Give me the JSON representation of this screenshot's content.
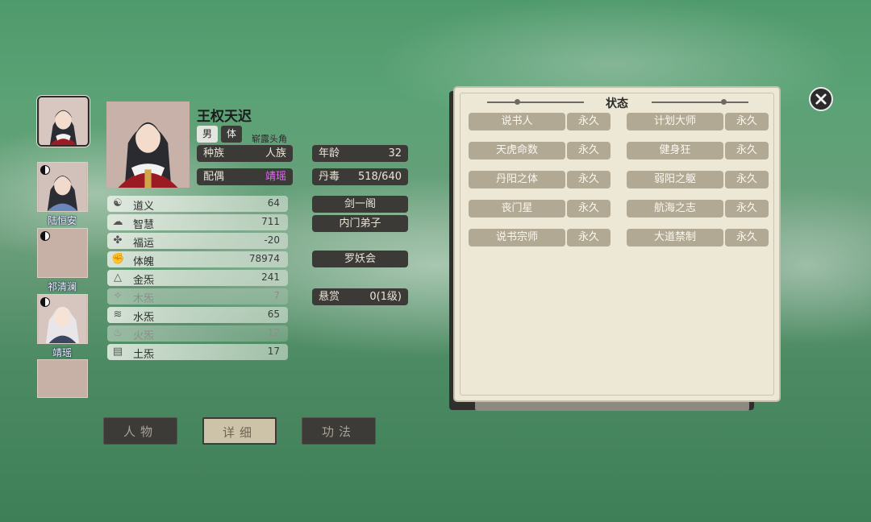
{
  "character": {
    "name": "王权天迟",
    "gender": "男",
    "type_tag": "体",
    "title": "崭露头角",
    "race_label": "种族",
    "race_value": "人族",
    "spouse_label": "配偶",
    "spouse_value": "靖瑶",
    "age_label": "年龄",
    "age_value": "32",
    "poison_label": "丹毒",
    "poison_value": "518/640",
    "sect": "剑一阁",
    "rank": "内门弟子",
    "organization": "罗妖会",
    "bounty_label": "悬赏",
    "bounty_value": "0(1级)"
  },
  "attributes": [
    {
      "label": "道义",
      "value": "64",
      "icon": "taiji-icon"
    },
    {
      "label": "智慧",
      "value": "711",
      "icon": "brain-icon"
    },
    {
      "label": "福运",
      "value": "-20",
      "icon": "clover-icon"
    },
    {
      "label": "体魄",
      "value": "78974",
      "icon": "fist-icon"
    },
    {
      "label": "金炁",
      "value": "241",
      "icon": "metal-icon"
    },
    {
      "label": "木炁",
      "value": "7",
      "icon": "wood-icon"
    },
    {
      "label": "水炁",
      "value": "65",
      "icon": "water-icon"
    },
    {
      "label": "火炁",
      "value": "12",
      "icon": "fire-icon"
    },
    {
      "label": "土炁",
      "value": "17",
      "icon": "earth-icon"
    }
  ],
  "party": [
    {
      "name": "陆恒安"
    },
    {
      "name": "祁清澜"
    },
    {
      "name": "靖瑶"
    }
  ],
  "status_panel": {
    "title": "状态",
    "items": [
      {
        "name": "说书人",
        "duration": "永久"
      },
      {
        "name": "计划大师",
        "duration": "永久"
      },
      {
        "name": "天虎命数",
        "duration": "永久"
      },
      {
        "name": "健身狂",
        "duration": "永久"
      },
      {
        "name": "丹阳之体",
        "duration": "永久"
      },
      {
        "name": "弱阳之躯",
        "duration": "永久"
      },
      {
        "name": "丧门星",
        "duration": "永久"
      },
      {
        "name": "航海之志",
        "duration": "永久"
      },
      {
        "name": "说书宗师",
        "duration": "永久"
      },
      {
        "name": "大道禁制",
        "duration": "永久"
      }
    ]
  },
  "tabs": {
    "character": "人物",
    "detail": "详细",
    "skills": "功法"
  },
  "colors": {
    "spouse_highlight": "#e36af5",
    "status_chip": "#b1a994",
    "panel_bg": "#ede7d6"
  }
}
